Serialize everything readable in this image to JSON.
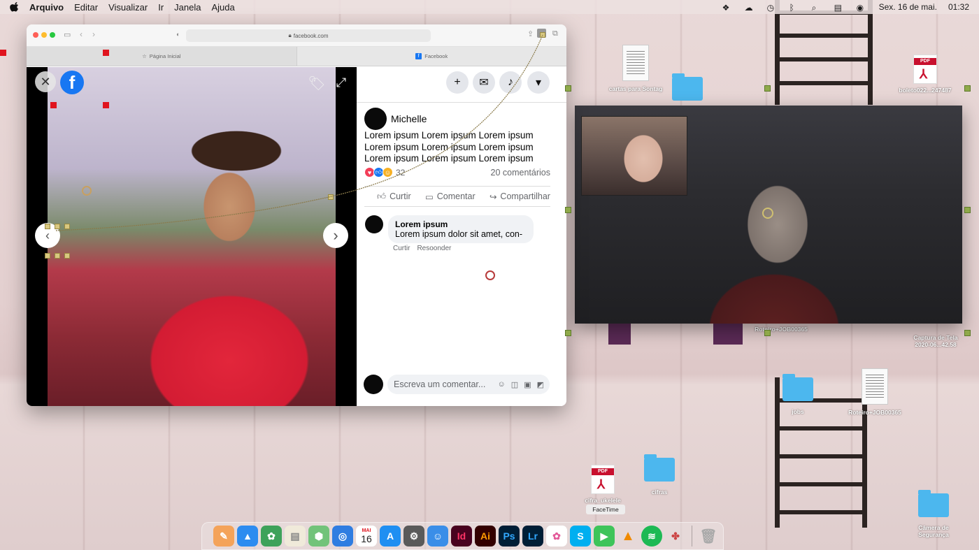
{
  "menubar": {
    "app_name": "Arquivo",
    "items": [
      "Editar",
      "Visualizar",
      "Ir",
      "Janela",
      "Ajuda"
    ],
    "date": "Sex. 16 de mai.",
    "time": "01:32"
  },
  "browser": {
    "url": "facebook.com",
    "tabs": [
      {
        "label": "Página Inicial",
        "icon": "star-icon"
      },
      {
        "label": "Facebook",
        "icon": "facebook-icon"
      }
    ]
  },
  "post": {
    "author": "Michelle",
    "text": "Lorem ipsum Lorem ipsum Lorem ipsum Lorem ipsum Lorem ipsum Lorem ipsum Lorem ipsum Lorem ipsum Lorem ipsum",
    "reaction_count": "32",
    "comments_count": "20 comentários",
    "actions": {
      "like": "Curtir",
      "comment": "Comentar",
      "share": "Compartilhar"
    }
  },
  "comment": {
    "author": "Lorem ipsum",
    "text": "Lorem ipsum dolor sit amet, con-",
    "like": "Curtir",
    "reply": "Resoonder"
  },
  "composer": {
    "placeholder": "Escreva um comentar..."
  },
  "desktop": {
    "icons": [
      {
        "label": "cartas para Sontag"
      },
      {
        "label": "boleto022...247487"
      },
      {
        "label": "Captura de Tela 2020-06...42.58"
      },
      {
        "label": "Roteiro+JOB00365"
      },
      {
        "label": "jobs"
      },
      {
        "label": "Roteiro+JOB00365"
      },
      {
        "label": "cifra_ukelele"
      },
      {
        "label": "cifras"
      },
      {
        "label": "FaceTime"
      },
      {
        "label": "Câmera de Segurança"
      }
    ]
  },
  "dock": {
    "calendar_month": "MAI",
    "calendar_day": "16",
    "app_labels": {
      "indesign": "Id",
      "illustrator": "Ai",
      "photoshop": "Ps",
      "lightroom": "Lr"
    }
  },
  "colors": {
    "facebook_blue": "#1877f2",
    "jersey_red": "#e2263b",
    "folder_blue": "#4cb7ee",
    "pdf_red": "#c8102e",
    "marker_green": "#8fa94a"
  }
}
